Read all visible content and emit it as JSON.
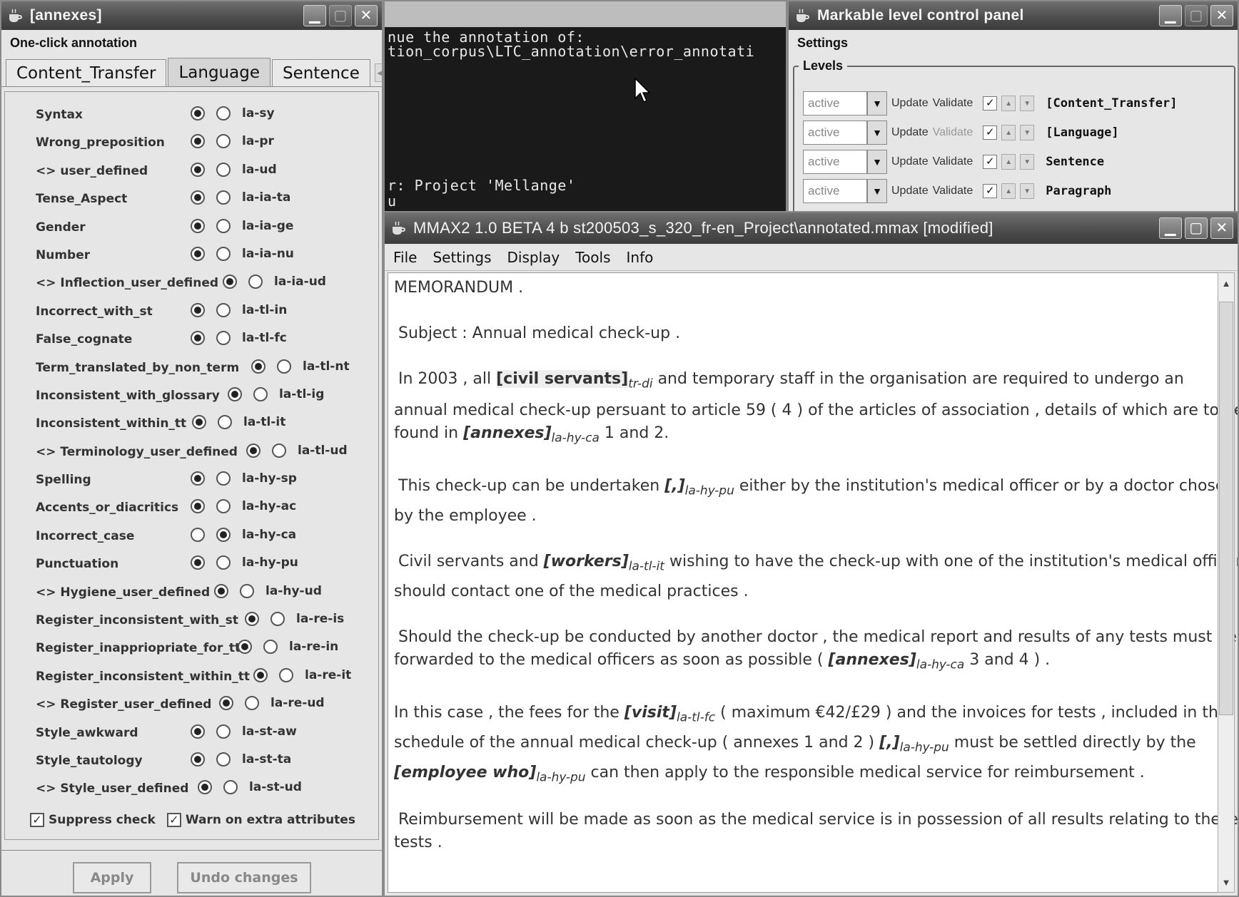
{
  "annexes_window": {
    "title": "[annexes]",
    "panel_title": "One-click annotation",
    "tabs": [
      "Content_Transfer",
      "Language",
      "Sentence"
    ],
    "selected_tab": "Language",
    "attributes": [
      {
        "label": "Syntax",
        "left_on": true,
        "value": "la-sy"
      },
      {
        "label": "Wrong_preposition",
        "left_on": true,
        "value": "la-pr"
      },
      {
        "label": "<> user_defined",
        "left_on": true,
        "value": "la-ud"
      },
      {
        "label": "Tense_Aspect",
        "left_on": true,
        "value": "la-ia-ta"
      },
      {
        "label": "Gender",
        "left_on": true,
        "value": "la-ia-ge"
      },
      {
        "label": "Number",
        "left_on": true,
        "value": "la-ia-nu"
      },
      {
        "label": "<> Inflection_user_defined",
        "left_on": true,
        "value": "la-ia-ud"
      },
      {
        "label": "Incorrect_with_st",
        "left_on": true,
        "value": "la-tl-in"
      },
      {
        "label": "False_cognate",
        "left_on": true,
        "value": "la-tl-fc"
      },
      {
        "label": "Term_translated_by_non_term",
        "left_on": true,
        "value": "la-tl-nt"
      },
      {
        "label": "Inconsistent_with_glossary",
        "left_on": true,
        "value": "la-tl-ig"
      },
      {
        "label": "Inconsistent_within_tt",
        "left_on": true,
        "value": "la-tl-it"
      },
      {
        "label": "<> Terminology_user_defined",
        "left_on": true,
        "value": "la-tl-ud"
      },
      {
        "label": "Spelling",
        "left_on": true,
        "value": "la-hy-sp"
      },
      {
        "label": "Accents_or_diacritics",
        "left_on": true,
        "value": "la-hy-ac"
      },
      {
        "label": "Incorrect_case",
        "left_on": false,
        "value": "la-hy-ca"
      },
      {
        "label": "Punctuation",
        "left_on": true,
        "value": "la-hy-pu"
      },
      {
        "label": "<> Hygiene_user_defined",
        "left_on": true,
        "value": "la-hy-ud"
      },
      {
        "label": "Register_inconsistent_with_st",
        "left_on": true,
        "value": "la-re-is"
      },
      {
        "label": "Register_inappriopriate_for_tt",
        "left_on": true,
        "value": "la-re-in"
      },
      {
        "label": "Register_inconsistent_within_tt",
        "left_on": true,
        "value": "la-re-it"
      },
      {
        "label": "<> Register_user_defined",
        "left_on": true,
        "value": "la-re-ud"
      },
      {
        "label": "Style_awkward",
        "left_on": true,
        "value": "la-st-aw"
      },
      {
        "label": "Style_tautology",
        "left_on": true,
        "value": "la-st-ta"
      },
      {
        "label": "<> Style_user_defined",
        "left_on": true,
        "value": "la-st-ud"
      }
    ],
    "suppress_check": "Suppress check",
    "warn_extra": "Warn on extra attributes",
    "apply": "Apply",
    "undo": "Undo changes"
  },
  "console": {
    "lines": [
      "nue the annotation of:",
      "tion_corpus\\LTC_annotation\\error_annotati",
      "r: Project 'Mellange'",
      "u"
    ]
  },
  "markable_panel": {
    "title": "Markable level control panel",
    "settings": "Settings",
    "levels_legend": "Levels",
    "update": "Update",
    "validate": "Validate",
    "levels": [
      {
        "state": "active",
        "name": "[Content_Transfer]",
        "validate_enabled": true
      },
      {
        "state": "active",
        "name": "[Language]",
        "validate_enabled": false
      },
      {
        "state": "active",
        "name": "Sentence",
        "validate_enabled": true
      },
      {
        "state": "active",
        "name": "Paragraph",
        "validate_enabled": true
      }
    ]
  },
  "mmax": {
    "title": "MMAX2 1.0 BETA 4 b st200503_s_320_fr-en_Project\\annotated.mmax [modified]",
    "menu": [
      "File",
      "Settings",
      "Display",
      "Tools",
      "Info"
    ],
    "doc": {
      "l1": "MEMORANDUM .",
      "l2": "Subject : Annual medical check-up .",
      "l3a": "In 2003 , all ",
      "l3m": "[civil servants]",
      "l3t": "tr-di",
      "l3b": " and temporary staff in the organisation are required to undergo an",
      "l4": "annual medical check-up persuant to article 59 ( 4 ) of the articles of association , details of which are to be",
      "l5a": "found in ",
      "l5m": "[annexes]",
      "l5t": "la-hy-ca",
      "l5b": " 1 and 2.",
      "l6a": "This check-up can be undertaken ",
      "l6m": "[,]",
      "l6t": "la-hy-pu",
      "l6b": " either by the institution's medical officer or by a doctor chosen",
      "l7": "by the employee .",
      "l8a": "Civil servants and ",
      "l8m": "[workers]",
      "l8t": "la-tl-it",
      "l8b": " wishing to have the check-up with one of the institution's medical officers",
      "l9": "should contact one of the medical practices .",
      "l10": "Should the check-up be conducted by another doctor , the medical report and results of any tests must be",
      "l11a": "forwarded to the medical officers as soon as possible ( ",
      "l11m": "[annexes]",
      "l11t": "la-hy-ca",
      "l11b": " 3 and 4 ) .",
      "l12a": "In this case , the fees for the ",
      "l12m": "[visit]",
      "l12t": "la-tl-fc",
      "l12b": " ( maximum €42/£29 ) and the invoices for tests , included in the",
      "l13a": "schedule of the annual medical check-up ( annexes 1 and 2 ) ",
      "l13m": "[,]",
      "l13t": "la-hy-pu",
      "l13b": " must be settled directly by the",
      "l14m": "[employee who]",
      "l14t": "la-hy-pu",
      "l14b": " can then apply to the responsible medical service for reimbursement .",
      "l15": "Reimbursement will be made as soon as the medical service is in possession of all results relating to these",
      "l16": "tests ."
    }
  }
}
